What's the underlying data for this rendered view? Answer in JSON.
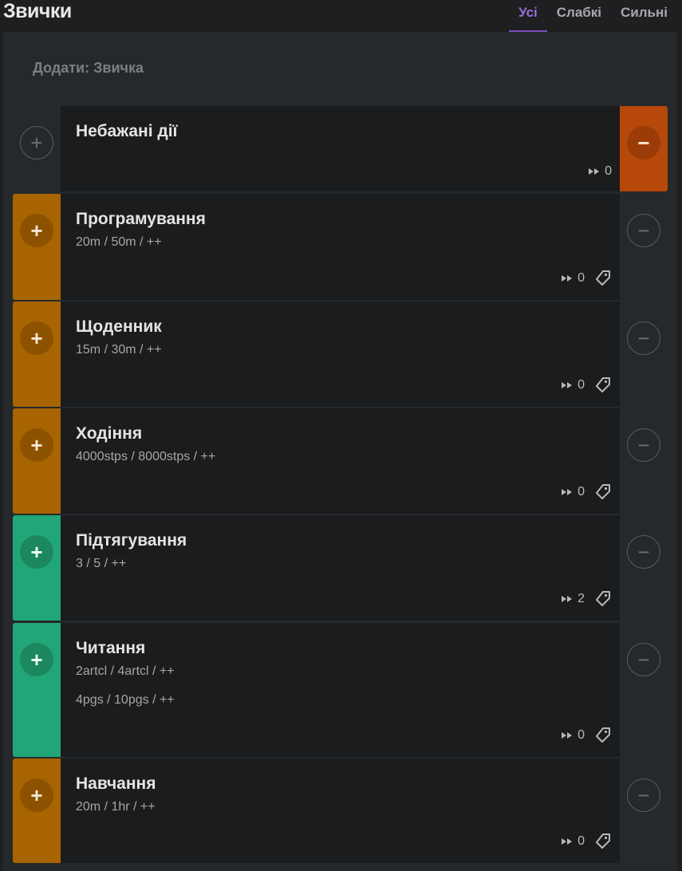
{
  "app": {
    "title": "Звички"
  },
  "tabs": [
    {
      "label": "Усі",
      "active": true
    },
    {
      "label": "Слабкі",
      "active": false
    },
    {
      "label": "Сильні",
      "active": false
    }
  ],
  "add": {
    "placeholder": "Додати: Звичка"
  },
  "habits": [
    {
      "name": "Небажані дії",
      "goals": [],
      "count": "0",
      "tag": false,
      "left": "none",
      "right": "red"
    },
    {
      "name": "Програмування",
      "goals": [
        "20m / 50m / ++"
      ],
      "count": "0",
      "tag": true,
      "left": "orange",
      "right": "none"
    },
    {
      "name": "Щоденник",
      "goals": [
        "15m / 30m / ++"
      ],
      "count": "0",
      "tag": true,
      "left": "orange",
      "right": "none"
    },
    {
      "name": "Ходіння",
      "goals": [
        "4000stps / 8000stps / ++"
      ],
      "count": "0",
      "tag": true,
      "left": "orange",
      "right": "none"
    },
    {
      "name": "Підтягування",
      "goals": [
        "3 / 5 / ++"
      ],
      "count": "2",
      "tag": true,
      "left": "green",
      "right": "none"
    },
    {
      "name": "Читання",
      "goals": [
        "2artcl / 4artcl / ++",
        "4pgs / 10pgs / ++"
      ],
      "count": "0",
      "tag": true,
      "left": "green",
      "right": "none"
    },
    {
      "name": "Навчання",
      "goals": [
        "20m / 1hr / ++"
      ],
      "count": "0",
      "tag": true,
      "left": "orange",
      "right": "none"
    }
  ],
  "colors": {
    "accent": "#7a4fc0",
    "orange": "#a76400",
    "green": "#21a678",
    "red": "#b6480a"
  },
  "icons": {
    "plus": "plus-icon",
    "minus": "minus-icon",
    "skip": "fast-forward-icon",
    "tag": "tag-icon"
  }
}
